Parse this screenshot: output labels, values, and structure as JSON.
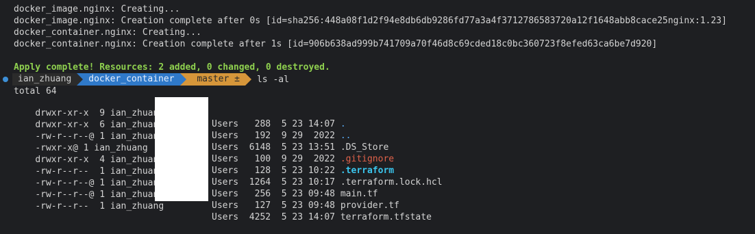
{
  "output": [
    "docker_image.nginx: Creating...",
    "docker_image.nginx: Creation complete after 0s [id=sha256:448a08f1d2f94e8db6db9286fd77a3a4f3712786583720a12f1648abb8cace25nginx:1.23]",
    "docker_container.nginx: Creating...",
    "docker_container.nginx: Creation complete after 1s [id=906b638ad999b741709a70f46d8c69cded18c0bc360723f8efed63ca6be7d920]"
  ],
  "apply_message": "Apply complete! Resources: 2 added, 0 changed, 0 destroyed.",
  "prompt": {
    "user": "ian_zhuang",
    "directory": "docker_container",
    "git_branch": " master ±",
    "command": "ls -al"
  },
  "total": "total 64",
  "listing": [
    {
      "prefix": "drwxr-xr-x  9 ian_zhuang",
      "mid": "Users   288  5 23 14:07 ",
      "name": "."
    },
    {
      "prefix": "drwxr-xr-x  6 ian_zhuang",
      "mid": "Users   192  9 29  2022 ",
      "name": ".."
    },
    {
      "prefix": "-rw-r--r--@ 1 ian_zhuang",
      "mid": "Users  6148  5 23 13:51 ",
      "name": ".DS_Store"
    },
    {
      "prefix": "-rwxr-x@ 1 ian_zhuang",
      "mid": "Users   100  9 29  2022 ",
      "name": ".gitignore"
    },
    {
      "prefix": "drwxr-xr-x  4 ian_zhuang",
      "mid": "Users   128  5 23 10:22 ",
      "name": ".terraform"
    },
    {
      "prefix": "-rw-r--r--  1 ian_zhuang",
      "mid": "Users  1264  5 23 10:17 ",
      "name": ".terraform.lock.hcl"
    },
    {
      "prefix": "-rw-r--r--@ 1 ian_zhuang",
      "mid": "Users   256  5 23 09:48 ",
      "name": "main.tf"
    },
    {
      "prefix": "-rw-r--r--@ 1 ian_zhuang",
      "mid": "Users   127  5 23 09:48 ",
      "name": "provider.tf"
    },
    {
      "prefix": "-rw-r--r--  1 ian_zhuang",
      "mid": "Users  4252  5 23 14:07 ",
      "name": "terraform.tfstate"
    }
  ],
  "colors": {
    "background": "#1e1f22",
    "apply_green": "#8fd14f",
    "dir_blue": "#59a8f0",
    "gitignore_red": "#e0624a",
    "terraform_cyan": "#3bc6ee",
    "prompt_dir_bg": "#2f79c9",
    "prompt_git_bg": "#d6963a"
  }
}
